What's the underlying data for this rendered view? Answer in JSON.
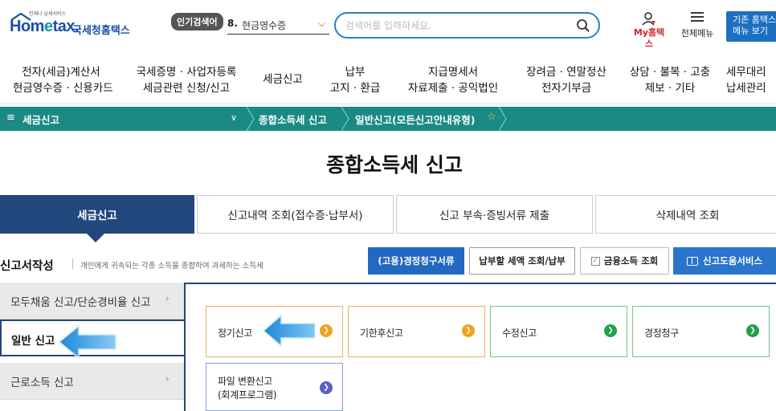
{
  "header": {
    "logo_sub": "언제나 납세서비스",
    "logo_hom": "Hom",
    "logo_e": "e",
    "logo_tax": "tax.",
    "logo_kr": "국세청홈택스",
    "popular_badge": "인기검색어",
    "popular_rank": "8.",
    "popular_term": "현금영수증",
    "search_placeholder": "검색어를 입력하세요.",
    "mytab_label": "My홈택스",
    "allmenu_label": "전체메뉴",
    "oldmenu_line1": "기존 홈택스",
    "oldmenu_line2": "메뉴 보기"
  },
  "mainnav": [
    {
      "line1": "전자(세금)계산서",
      "line2": "현금영수증 · 신용카드"
    },
    {
      "line1": "국세증명 · 사업자등록",
      "line2": "세금관련 신청/신고"
    },
    {
      "line1": "세금신고",
      "line2": ""
    },
    {
      "line1": "납부",
      "line2": "고지 · 환급"
    },
    {
      "line1": "지급명세서",
      "line2": "자료제출 · 공익법인"
    },
    {
      "line1": "장려금 · 연말정산",
      "line2": "전자기부금"
    },
    {
      "line1": "상담 · 불복 · 고충",
      "line2": "제보 · 기타"
    },
    {
      "line1": "세무대리",
      "line2": "납세관리"
    }
  ],
  "breadcrumb": {
    "root": "세금신고",
    "mid": "종합소득세 신고",
    "current": "일반신고(모든신고안내유형)"
  },
  "page_title": "종합소득세 신고",
  "tabs": [
    "세금신고",
    "신고내역 조회(접수증·납부서)",
    "신고 부속·증빙서류 제출",
    "삭제내역 조회"
  ],
  "section": {
    "title": "신고서작성",
    "desc": "개인에게 귀속되는 각종 소득을 종합하여 과세하는 소득세"
  },
  "action_buttons": {
    "refund": "(고용)경정청구서류",
    "tax_due": "납부할 세액 조회/납부",
    "finance": "금융소득 조회",
    "help": "신고도움서비스"
  },
  "side_menu": [
    {
      "label": "모두채움 신고/단순경비율 신고"
    },
    {
      "label": "일반 신고"
    },
    {
      "label": "근로소득 신고"
    }
  ],
  "cards": {
    "regular": "정기신고",
    "late": "기한후신고",
    "amended": "수정신고",
    "correction": "경정청구",
    "file_line1": "파일 변환신고",
    "file_line2": "(회계프로그램)"
  },
  "colors": {
    "navy": "#22477c",
    "teal": "#1b8a84",
    "brand_blue": "#1c4fa8",
    "orange": "#f2a21b",
    "green": "#1fa24b",
    "purple": "#5560c6",
    "callout_arrow": "#3a9be0"
  }
}
